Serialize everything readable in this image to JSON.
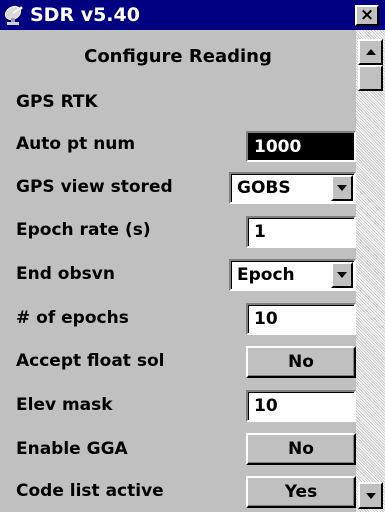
{
  "window": {
    "title": "SDR v5.40",
    "close_label": "×"
  },
  "page": {
    "heading": "Configure Reading",
    "section": "GPS RTK"
  },
  "rows": {
    "auto_pt_num": {
      "label": "Auto pt num",
      "value": "1000"
    },
    "gps_view_stored": {
      "label": "GPS view stored",
      "value": "GOBS"
    },
    "epoch_rate": {
      "label": "Epoch rate (s)",
      "value": "1"
    },
    "end_obsvn": {
      "label": "End obsvn",
      "value": "Epoch"
    },
    "num_epochs": {
      "label": "# of epochs",
      "value": "10"
    },
    "accept_float_sol": {
      "label": "Accept float sol",
      "value": "No"
    },
    "elev_mask": {
      "label": "Elev mask",
      "value": "10"
    },
    "enable_gga": {
      "label": "Enable GGA",
      "value": "No"
    },
    "code_list_active": {
      "label": "Code list active",
      "value": "Yes"
    }
  },
  "icons": {
    "app": "satellite-dish-icon",
    "close": "close-icon",
    "scroll_up": "scroll-up-arrow-icon",
    "scroll_down": "scroll-down-arrow-icon",
    "dropdown": "dropdown-arrow-icon"
  },
  "colors": {
    "titlebar": "#000080",
    "surface": "#c0c0c0",
    "selected_field_bg": "#000000",
    "selected_field_text": "#ffffff"
  }
}
